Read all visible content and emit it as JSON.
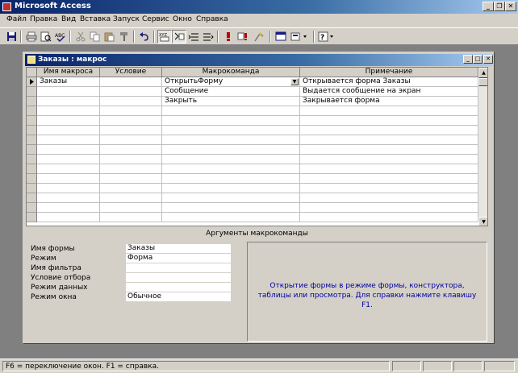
{
  "app": {
    "title": "Microsoft Access"
  },
  "menubar": {
    "items": [
      "Файл",
      "Правка",
      "Вид",
      "Вставка",
      "Запуск",
      "Сервис",
      "Окно",
      "Справка"
    ]
  },
  "toolbar": {
    "buttons": [
      {
        "icon": "save-icon"
      },
      {
        "icon": "print-icon"
      },
      {
        "icon": "print-preview-icon"
      },
      {
        "icon": "spelling-icon"
      },
      {
        "icon": "cut-icon"
      },
      {
        "icon": "copy-icon"
      },
      {
        "icon": "paste-icon"
      },
      {
        "icon": "format-painter-icon"
      },
      {
        "icon": "undo-icon"
      },
      {
        "icon": "macro-names-icon"
      },
      {
        "icon": "conditions-icon"
      },
      {
        "icon": "insert-rows-icon"
      },
      {
        "icon": "delete-rows-icon"
      },
      {
        "icon": "run-icon"
      },
      {
        "icon": "single-step-icon"
      },
      {
        "icon": "build-icon"
      },
      {
        "icon": "database-window-icon"
      },
      {
        "icon": "new-object-icon"
      },
      {
        "icon": "help-icon"
      }
    ]
  },
  "macro_window": {
    "title": "Заказы : макрос",
    "columns": [
      "Имя макроса",
      "Условие",
      "Макрокоманда",
      "Примечание"
    ],
    "rows": [
      {
        "name": "Заказы",
        "condition": "",
        "action": "ОткрытьФорму",
        "comment": "Открывается форма Заказы"
      },
      {
        "name": "",
        "condition": "",
        "action": "Сообщение",
        "comment": "Выдается сообщение на экран"
      },
      {
        "name": "",
        "condition": "",
        "action": "Закрыть",
        "comment": "Закрывается форма"
      }
    ],
    "arguments_title": "Аргументы макрокоманды",
    "arguments": [
      {
        "label": "Имя формы",
        "value": "Заказы"
      },
      {
        "label": "Режим",
        "value": "Форма"
      },
      {
        "label": "Имя фильтра",
        "value": ""
      },
      {
        "label": "Условие отбора",
        "value": ""
      },
      {
        "label": "Режим данных",
        "value": ""
      },
      {
        "label": "Режим окна",
        "value": "Обычное"
      }
    ],
    "help_text": "Открытие формы в режиме формы, конструктора, таблицы или просмотра. Для справки нажмите клавишу F1."
  },
  "statusbar": {
    "text": "F6 = переключение окон.  F1 = справка."
  }
}
